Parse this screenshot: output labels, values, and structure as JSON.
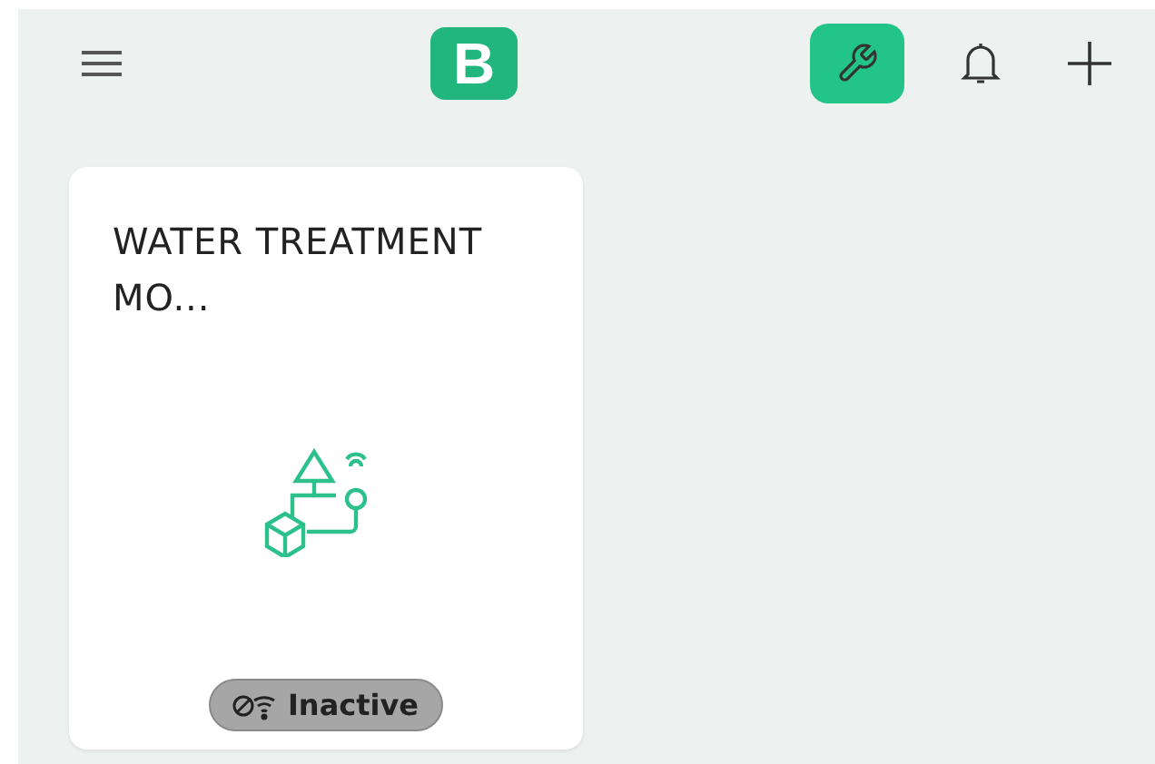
{
  "header": {
    "logo": "B",
    "tools_active": true
  },
  "devices": [
    {
      "title": "WATER TREATMENT MO...",
      "status": {
        "label": "Inactive",
        "online": false
      }
    }
  ]
}
